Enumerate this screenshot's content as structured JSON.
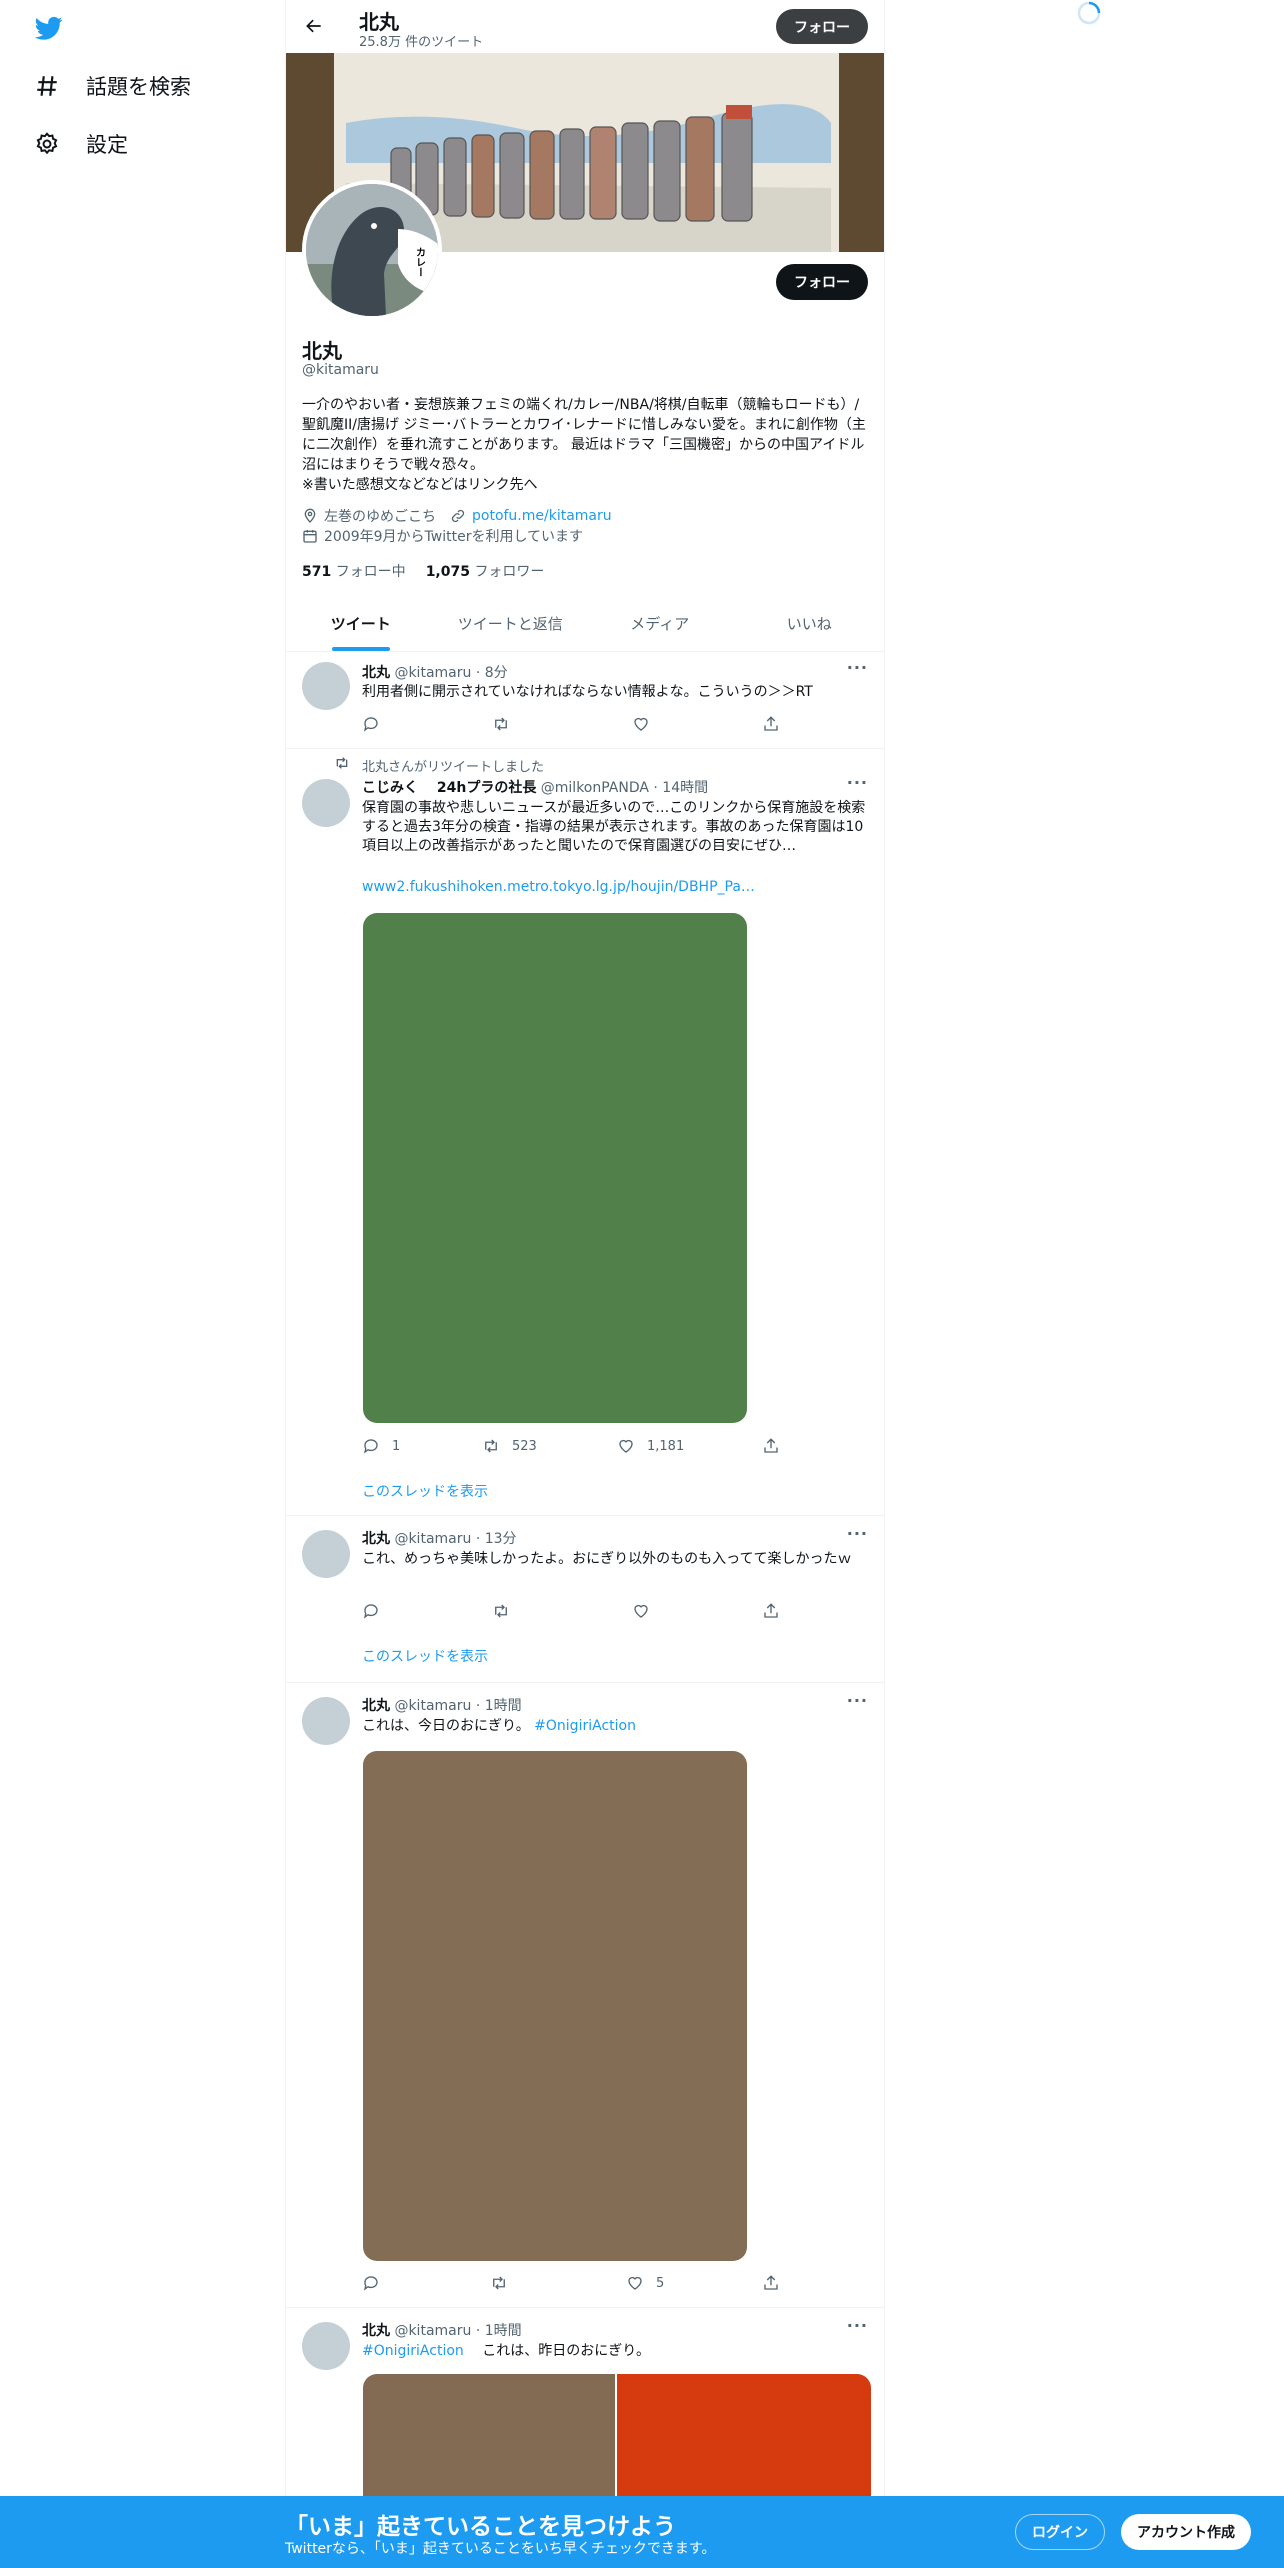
{
  "nav": {
    "logo_icon": "twitter-bird-icon",
    "explore_label": "話題を検索",
    "settings_label": "設定"
  },
  "header": {
    "name": "北丸",
    "tweet_count": "25.8万 件のツイート",
    "follow_label": "フォロー"
  },
  "profile": {
    "avatar_caption": "カレー",
    "follow_label": "フォロー",
    "name": "北丸",
    "handle": "@kitamaru",
    "bio": "一介のやおい者・妄想族兼フェミの端くれ/カレー/NBA/将棋/自転車（競輪もロードも）/聖飢魔II/唐揚げ ジミー･バトラーとカワイ･レナードに惜しみない愛を。まれに創作物（主に二次創作）を垂れ流すことがあります。 最近はドラマ「三国機密」からの中国アイドル沼にはまりそうで戦々恐々。\n※書いた感想文などなどはリンク先へ",
    "location": "左巻のゆめごこち",
    "url": "potofu.me/kitamaru",
    "joined": "2009年9月からTwitterを利用しています",
    "following_count": "571",
    "following_label": "フォロー中",
    "followers_count": "1,075",
    "followers_label": "フォロワー"
  },
  "tabs": [
    {
      "label": "ツイート",
      "active": true
    },
    {
      "label": "ツイートと返信",
      "active": false
    },
    {
      "label": "メディア",
      "active": false
    },
    {
      "label": "いいね",
      "active": false
    }
  ],
  "tweets": [
    {
      "name": "北丸",
      "meta": "@kitamaru · 8分",
      "text": "利用者側に開示されていなければならない情報よな。こういうの＞＞RT",
      "reply": "",
      "retweet": "",
      "like": ""
    },
    {
      "retweet_note": "北丸さんがリツイートしました",
      "name": "こじみく　 24hプラの社長",
      "meta": "@milkonPANDA · 14時間",
      "text": "保育園の事故や悲しいニュースが最近多いので…このリンクから保育施設を検索すると過去3年分の検査・指導の結果が表示されます。事故のあった保育園は10項目以上の改善指示があったと聞いたので保育園選びの目安にぜひ…",
      "link": "www2.fukushihoken.metro.tokyo.lg.jp/houjin/DBHP_Pa…",
      "media_color": "#52804a",
      "reply": "1",
      "retweet": "523",
      "like": "1,181",
      "thread_label": "このスレッドを表示"
    },
    {
      "name": "北丸",
      "meta": "@kitamaru · 13分",
      "text": "これ、めっちゃ美味しかったよ。おにぎり以外のものも入ってて楽しかったｗ",
      "reply": "",
      "retweet": "",
      "like": "",
      "thread_label": "このスレッドを表示"
    },
    {
      "name": "北丸",
      "meta": "@kitamaru · 1時間",
      "text": "これは、今日のおにぎり。 ",
      "hashtag": "#OnigiriAction",
      "media_color": "#836d55",
      "reply": "",
      "retweet": "",
      "like": "5"
    },
    {
      "name": "北丸",
      "meta": "@kitamaru · 1時間",
      "hashtag": "#OnigiriAction",
      "text": " 　これは、昨日のおにぎり。",
      "media_colors": [
        "#836a52",
        "#d63b10"
      ]
    }
  ],
  "bottom_bar": {
    "title": "「いま」起きていることを見つけよう",
    "subtitle": "Twitterなら、「いま」起きていることをいち早くチェックできます。",
    "login_label": "ログイン",
    "signup_label": "アカウント作成"
  },
  "colors": {
    "accent": "#1d9bf0",
    "text": "#0f1419",
    "secondary": "#536471"
  }
}
